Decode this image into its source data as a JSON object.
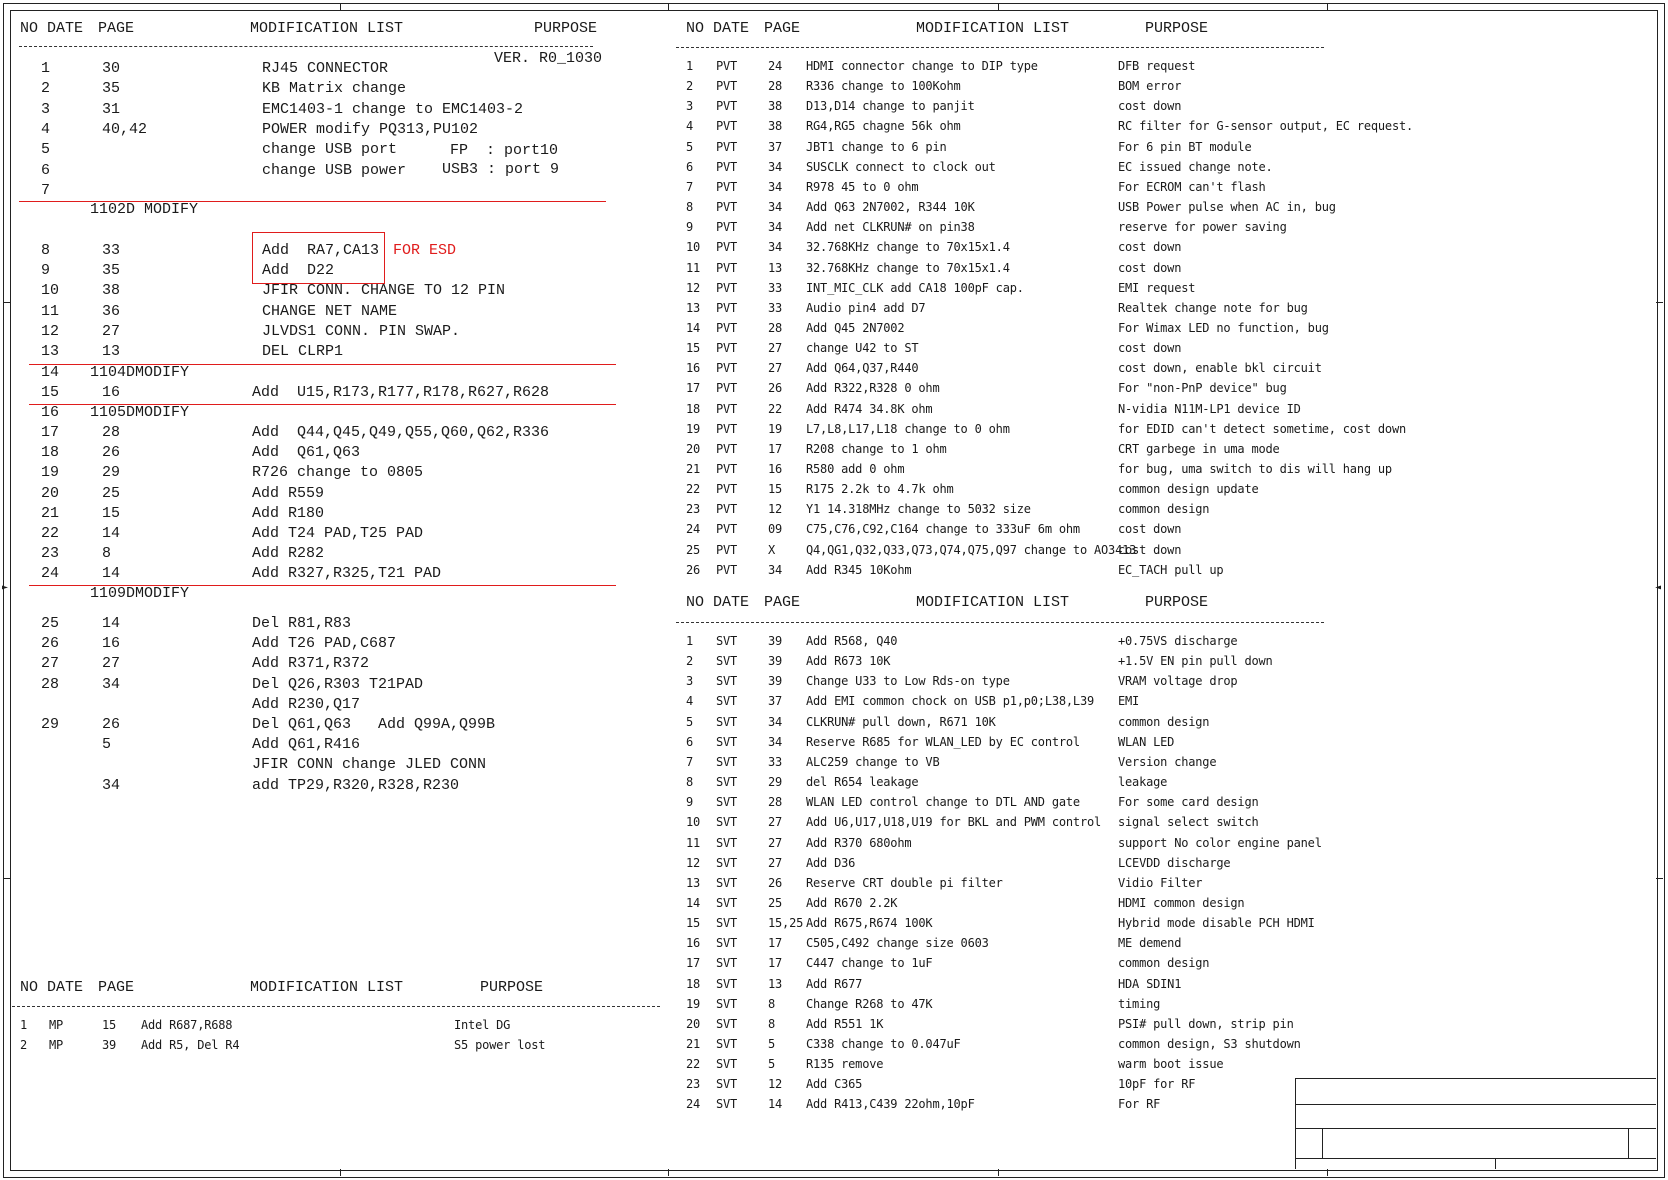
{
  "accent_color": "#e01c1c",
  "left_table": {
    "headers": {
      "no_date": "NO DATE",
      "page": "PAGE",
      "mod": "MODIFICATION LIST",
      "purpose": "PURPOSE"
    },
    "version": "VER. R0_1030",
    "rows": [
      {
        "no": "1",
        "page": "30",
        "mod": "RJ45 CONNECTOR"
      },
      {
        "no": "2",
        "page": "35",
        "mod": "KB Matrix change"
      },
      {
        "no": "3",
        "page": "31",
        "mod": "EMC1403-1 change to EMC1403-2"
      },
      {
        "no": "4",
        "page": "40,42",
        "mod": "POWER modify PQ313,PU102"
      },
      {
        "no": "5",
        "page": "",
        "mod": "change USB port"
      },
      {
        "no": "6",
        "page": "",
        "mod": "change USB power"
      },
      {
        "no": "7",
        "page": "",
        "mod": ""
      }
    ],
    "usb_note_1": "FP  : port10",
    "usb_note_2": "USB3 : port 9",
    "section_1102d": "1102D MODIFY",
    "rows2": [
      {
        "no": "8",
        "page": "33",
        "mod": "Add  RA7,CA13"
      },
      {
        "no": "9",
        "page": "35",
        "mod": "Add  D22"
      },
      {
        "no": "10",
        "page": "38",
        "mod": "JFIR CONN. CHANGE TO 12 PIN"
      },
      {
        "no": "11",
        "page": "36",
        "mod": "CHANGE NET NAME"
      },
      {
        "no": "12",
        "page": "27",
        "mod": "JLVDS1 CONN. PIN SWAP."
      },
      {
        "no": "13",
        "page": "13",
        "mod": "DEL CLRP1"
      }
    ],
    "esd_note": "FOR ESD",
    "section_1104d": {
      "no": "14",
      "label": "1104DMODIFY"
    },
    "row15": {
      "no": "15",
      "page": "16",
      "mod": "Add  U15,R173,R177,R178,R627,R628"
    },
    "section_1105d": {
      "no": "16",
      "label": "1105DMODIFY"
    },
    "rows3": [
      {
        "no": "17",
        "page": "28",
        "mod": "Add  Q44,Q45,Q49,Q55,Q60,Q62,R336"
      },
      {
        "no": "18",
        "page": "26",
        "mod": "Add  Q61,Q63"
      },
      {
        "no": "19",
        "page": "29",
        "mod": "R726 change to 0805"
      },
      {
        "no": "20",
        "page": "25",
        "mod": "Add R559"
      },
      {
        "no": "21",
        "page": "15",
        "mod": "Add R180"
      },
      {
        "no": "22",
        "page": "14",
        "mod": "Add T24 PAD,T25 PAD"
      },
      {
        "no": "23",
        "page": "8",
        "mod": "Add R282"
      },
      {
        "no": "24",
        "page": "14",
        "mod": "Add R327,R325,T21 PAD"
      }
    ],
    "section_1109d": "1109DMODIFY",
    "rows4": [
      {
        "no": "25",
        "page": "14",
        "mod": "Del R81,R83"
      },
      {
        "no": "26",
        "page": "16",
        "mod": "Add T26 PAD,C687"
      },
      {
        "no": "27",
        "page": "27",
        "mod": "Add R371,R372"
      },
      {
        "no": "28",
        "page": "34",
        "mod": "Del Q26,R303 T21PAD"
      },
      {
        "no": "",
        "page": "",
        "mod": "Add R230,Q17"
      },
      {
        "no": "29",
        "page": "26",
        "mod": "Del Q61,Q63   Add Q99A,Q99B"
      },
      {
        "no": "",
        "page": "5",
        "mod": "Add Q61,R416"
      },
      {
        "no": "",
        "page": "",
        "mod": "JFIR CONN change JLED CONN"
      },
      {
        "no": "",
        "page": "34",
        "mod": "add TP29,R320,R328,R230"
      }
    ]
  },
  "mp_table": {
    "headers": {
      "no_date": "NO DATE",
      "page": "PAGE",
      "mod": "MODIFICATION LIST",
      "purpose": "PURPOSE"
    },
    "rows": [
      {
        "no": "1",
        "stage": "MP",
        "page": "15",
        "mod": "Add R687,R688",
        "purpose": "Intel DG"
      },
      {
        "no": "2",
        "stage": "MP",
        "page": "39",
        "mod": "Add R5, Del R4",
        "purpose": "S5 power lost"
      }
    ]
  },
  "pvt_table": {
    "headers": {
      "no_date": "NO DATE",
      "page": "PAGE",
      "mod": "MODIFICATION LIST",
      "purpose": "PURPOSE"
    },
    "rows": [
      {
        "no": "1",
        "stage": "PVT",
        "page": "24",
        "mod": "HDMI connector change to DIP type",
        "purpose": "DFB request"
      },
      {
        "no": "2",
        "stage": "PVT",
        "page": "28",
        "mod": "R336 change to 100Kohm",
        "purpose": "BOM error"
      },
      {
        "no": "3",
        "stage": "PVT",
        "page": "38",
        "mod": "D13,D14 change to panjit",
        "purpose": "cost down"
      },
      {
        "no": "4",
        "stage": "PVT",
        "page": "38",
        "mod": "RG4,RG5 chagne 56k ohm",
        "purpose": "RC filter for G-sensor output, EC request."
      },
      {
        "no": "5",
        "stage": "PVT",
        "page": "37",
        "mod": "JBT1 change to 6 pin",
        "purpose": "For 6 pin BT module"
      },
      {
        "no": "6",
        "stage": "PVT",
        "page": "34",
        "mod": "SUSCLK connect to clock out",
        "purpose": "EC issued change note."
      },
      {
        "no": "7",
        "stage": "PVT",
        "page": "34",
        "mod": "R978 45 to 0 ohm",
        "purpose": "For ECROM can't flash"
      },
      {
        "no": "8",
        "stage": "PVT",
        "page": "34",
        "mod": "Add Q63 2N7002, R344 10K",
        "purpose": "USB Power pulse when AC in, bug"
      },
      {
        "no": "9",
        "stage": "PVT",
        "page": "34",
        "mod": "Add net CLKRUN# on pin38",
        "purpose": "reserve for power saving"
      },
      {
        "no": "10",
        "stage": "PVT",
        "page": "34",
        "mod": "32.768KHz change to 70x15x1.4",
        "purpose": "cost down"
      },
      {
        "no": "11",
        "stage": "PVT",
        "page": "13",
        "mod": "32.768KHz change to 70x15x1.4",
        "purpose": "cost down"
      },
      {
        "no": "12",
        "stage": "PVT",
        "page": "33",
        "mod": "INT_MIC_CLK add CA18 100pF cap.",
        "purpose": "EMI request"
      },
      {
        "no": "13",
        "stage": "PVT",
        "page": "33",
        "mod": "Audio pin4 add D7",
        "purpose": "Realtek change note for bug"
      },
      {
        "no": "14",
        "stage": "PVT",
        "page": "28",
        "mod": "Add Q45 2N7002",
        "purpose": "For Wimax LED no function, bug"
      },
      {
        "no": "15",
        "stage": "PVT",
        "page": "27",
        "mod": "change U42 to ST",
        "purpose": "cost down"
      },
      {
        "no": "16",
        "stage": "PVT",
        "page": "27",
        "mod": "Add Q64,Q37,R440",
        "purpose": "cost down, enable bkl circuit"
      },
      {
        "no": "17",
        "stage": "PVT",
        "page": "26",
        "mod": "Add R322,R328 0 ohm",
        "purpose": "For \"non-PnP device\" bug"
      },
      {
        "no": "18",
        "stage": "PVT",
        "page": "22",
        "mod": "Add R474 34.8K ohm",
        "purpose": "N-vidia N11M-LP1 device ID"
      },
      {
        "no": "19",
        "stage": "PVT",
        "page": "19",
        "mod": "L7,L8,L17,L18 change to 0 ohm",
        "purpose": "for EDID can't detect sometime, cost down"
      },
      {
        "no": "20",
        "stage": "PVT",
        "page": "17",
        "mod": "R208 change to 1 ohm",
        "purpose": "CRT garbege in uma mode"
      },
      {
        "no": "21",
        "stage": "PVT",
        "page": "16",
        "mod": "R580 add 0 ohm",
        "purpose": "for bug, uma switch to dis will hang up"
      },
      {
        "no": "22",
        "stage": "PVT",
        "page": "15",
        "mod": "R175 2.2k to 4.7k ohm",
        "purpose": "common design update"
      },
      {
        "no": "23",
        "stage": "PVT",
        "page": "12",
        "mod": "Y1 14.318MHz change to 5032 size",
        "purpose": "common design"
      },
      {
        "no": "24",
        "stage": "PVT",
        "page": "09",
        "mod": "C75,C76,C92,C164 change to 333uF 6m ohm",
        "purpose": "cost down"
      },
      {
        "no": "25",
        "stage": "PVT",
        "page": "X",
        "mod": "Q4,QG1,Q32,Q33,Q73,Q74,Q75,Q97 change to AO3413",
        "purpose": "cost down"
      },
      {
        "no": "26",
        "stage": "PVT",
        "page": "34",
        "mod": "Add R345 10Kohm",
        "purpose": "EC_TACH pull up"
      }
    ]
  },
  "svt_table": {
    "headers": {
      "no_date": "NO DATE",
      "page": "PAGE",
      "mod": "MODIFICATION LIST",
      "purpose": "PURPOSE"
    },
    "rows": [
      {
        "no": "1",
        "stage": "SVT",
        "page": "39",
        "mod": "Add R568, Q40",
        "purpose": "+0.75VS discharge"
      },
      {
        "no": "2",
        "stage": "SVT",
        "page": "39",
        "mod": "Add R673 10K",
        "purpose": "+1.5V EN pin pull down"
      },
      {
        "no": "3",
        "stage": "SVT",
        "page": "39",
        "mod": "Change U33 to Low Rds-on type",
        "purpose": "VRAM voltage drop"
      },
      {
        "no": "4",
        "stage": "SVT",
        "page": "37",
        "mod": "Add EMI common chock on USB p1,p0;L38,L39",
        "purpose": "EMI"
      },
      {
        "no": "5",
        "stage": "SVT",
        "page": "34",
        "mod": "CLKRUN# pull down, R671 10K",
        "purpose": "common design"
      },
      {
        "no": "6",
        "stage": "SVT",
        "page": "34",
        "mod": "Reserve R685 for WLAN_LED by EC control",
        "purpose": "WLAN LED"
      },
      {
        "no": "7",
        "stage": "SVT",
        "page": "33",
        "mod": "ALC259 change to VB",
        "purpose": "Version change"
      },
      {
        "no": "8",
        "stage": "SVT",
        "page": "29",
        "mod": "del R654 leakage",
        "purpose": "leakage"
      },
      {
        "no": "9",
        "stage": "SVT",
        "page": "28",
        "mod": "WLAN LED control change to DTL AND gate",
        "purpose": "For some card design"
      },
      {
        "no": "10",
        "stage": "SVT",
        "page": "27",
        "mod": "Add U6,U17,U18,U19 for BKL and PWM control",
        "purpose": "signal select switch"
      },
      {
        "no": "11",
        "stage": "SVT",
        "page": "27",
        "mod": "Add R370 680ohm",
        "purpose": "support No color engine panel"
      },
      {
        "no": "12",
        "stage": "SVT",
        "page": "27",
        "mod": "Add D36",
        "purpose": "LCEVDD discharge"
      },
      {
        "no": "13",
        "stage": "SVT",
        "page": "26",
        "mod": "Reserve CRT double pi filter",
        "purpose": "Vidio Filter"
      },
      {
        "no": "14",
        "stage": "SVT",
        "page": "25",
        "mod": "Add R670 2.2K",
        "purpose": "HDMI common design"
      },
      {
        "no": "15",
        "stage": "SVT",
        "page": "15,25",
        "mod": "Add R675,R674 100K",
        "purpose": "Hybrid mode disable PCH HDMI"
      },
      {
        "no": "16",
        "stage": "SVT",
        "page": "17",
        "mod": "C505,C492 change size 0603",
        "purpose": "ME demend"
      },
      {
        "no": "17",
        "stage": "SVT",
        "page": "17",
        "mod": "C447 change to 1uF",
        "purpose": "common design"
      },
      {
        "no": "18",
        "stage": "SVT",
        "page": "13",
        "mod": "Add R677",
        "purpose": "HDA SDIN1"
      },
      {
        "no": "19",
        "stage": "SVT",
        "page": "8",
        "mod": "Change R268 to 47K",
        "purpose": "timing"
      },
      {
        "no": "20",
        "stage": "SVT",
        "page": "8",
        "mod": "Add R551 1K",
        "purpose": "PSI# pull down, strip pin"
      },
      {
        "no": "21",
        "stage": "SVT",
        "page": "5",
        "mod": "C338 change to 0.047uF",
        "purpose": "common design, S3 shutdown"
      },
      {
        "no": "22",
        "stage": "SVT",
        "page": "5",
        "mod": "R135 remove",
        "purpose": "warm boot issue"
      },
      {
        "no": "23",
        "stage": "SVT",
        "page": "12",
        "mod": "Add C365",
        "purpose": "10pF for RF"
      },
      {
        "no": "24",
        "stage": "SVT",
        "page": "14",
        "mod": "Add R413,C439 22ohm,10pF",
        "purpose": "For RF"
      }
    ]
  }
}
